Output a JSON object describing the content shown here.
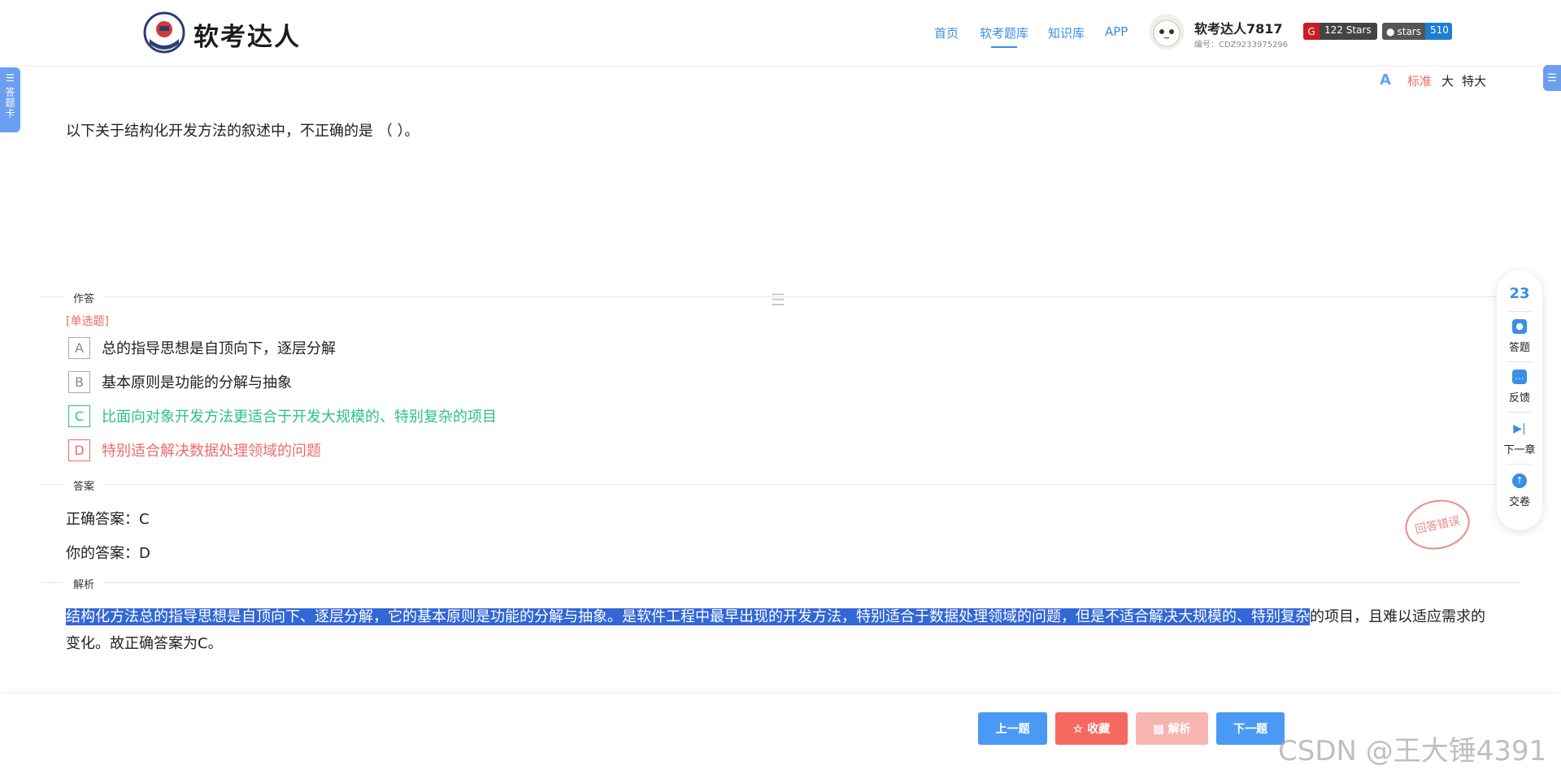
{
  "header": {
    "brand": "软考达人",
    "nav": [
      "首页",
      "软考题库",
      "知识库",
      "APP"
    ],
    "user_name": "软考达人7817",
    "user_id": "编号：CDZ9233975296",
    "badge_stars_label": "122 Stars",
    "badge_github_label": "stars",
    "badge_github_count": "510"
  },
  "left_tab": {
    "label": "答题卡"
  },
  "font_size": {
    "options": [
      "标准",
      "大",
      "特大"
    ],
    "selected": "标准"
  },
  "question": {
    "text": "以下关于结构化开发方法的叙述中，不正确的是 （ ）。"
  },
  "answer_section": {
    "label": "作答",
    "type": "[单选题]",
    "options": [
      {
        "letter": "A",
        "text": "总的指导思想是自顶向下，逐层分解",
        "state": "normal"
      },
      {
        "letter": "B",
        "text": "基本原则是功能的分解与抽象",
        "state": "normal"
      },
      {
        "letter": "C",
        "text": "比面向对象开发方法更适合于开发大规模的、特别复杂的项目",
        "state": "correct"
      },
      {
        "letter": "D",
        "text": "特别适合解决数据处理领域的问题",
        "state": "wrong"
      }
    ]
  },
  "result_section": {
    "label": "答案",
    "correct": "正确答案：C",
    "yours": "你的答案：D",
    "stamp": "回答错误"
  },
  "analysis_section": {
    "label": "解析",
    "highlighted": "结构化方法总的指导思想是自顶向下、逐层分解，它的基本原则是功能的分解与抽象。是软件工程中最早出现的开发方法，特别适合于数据处理领域的问题，但是不适合解决大规模的、特别复杂",
    "rest": "的项目，且难以适应需求的变化。故正确答案为C。"
  },
  "float_bar": {
    "number": "23",
    "items": [
      "答题",
      "反馈",
      "下一章",
      "交卷"
    ]
  },
  "bottom": {
    "prev": "上一题",
    "favorite": "收藏",
    "analysis": "解析",
    "next": "下一题"
  },
  "watermark": "CSDN @王大锤4391",
  "colors": {
    "accent": "#3a8ee6",
    "correct": "#2bbf8e",
    "wrong": "#f06a6a",
    "highlight": "#3367d6"
  }
}
